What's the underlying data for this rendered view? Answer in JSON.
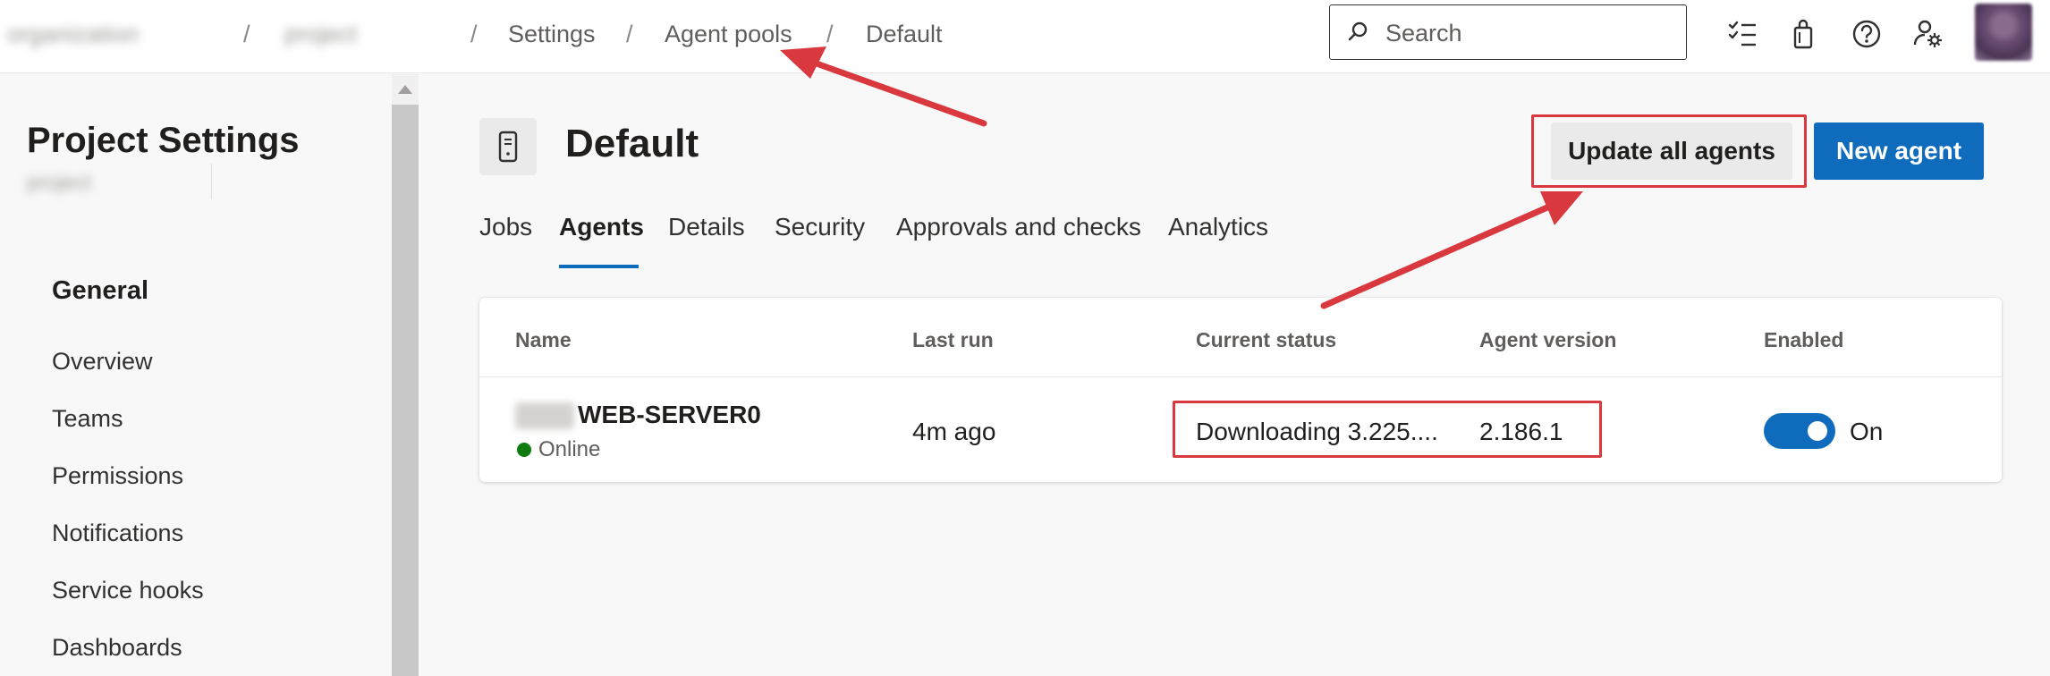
{
  "breadcrumb": {
    "items": [
      "organization",
      "project",
      "Settings",
      "Agent pools",
      "Default"
    ],
    "separator": "/"
  },
  "search": {
    "placeholder": "Search"
  },
  "topbar_icons": [
    "task-list-icon",
    "shopping-bag-icon",
    "help-icon",
    "user-settings-icon",
    "avatar"
  ],
  "sidebar": {
    "title": "Project Settings",
    "subtitle": "project",
    "section": "General",
    "items": [
      "Overview",
      "Teams",
      "Permissions",
      "Notifications",
      "Service hooks",
      "Dashboards"
    ]
  },
  "main": {
    "title": "Default",
    "buttons": {
      "update_all": "Update all agents",
      "new_agent": "New agent"
    },
    "tabs": [
      "Jobs",
      "Agents",
      "Details",
      "Security",
      "Approvals and checks",
      "Analytics"
    ],
    "active_tab": "Agents"
  },
  "table": {
    "columns": [
      "Name",
      "Last run",
      "Current status",
      "Agent version",
      "Enabled"
    ],
    "rows": [
      {
        "name": "WEB-SERVER0",
        "status_label": "Online",
        "last_run": "4m ago",
        "current_status": "Downloading 3.225....",
        "agent_version": "2.186.1",
        "enabled": true,
        "enabled_label": "On"
      }
    ]
  },
  "colors": {
    "accent": "#0f6cbd",
    "online": "#107c10",
    "annotation": "#d9383e"
  }
}
